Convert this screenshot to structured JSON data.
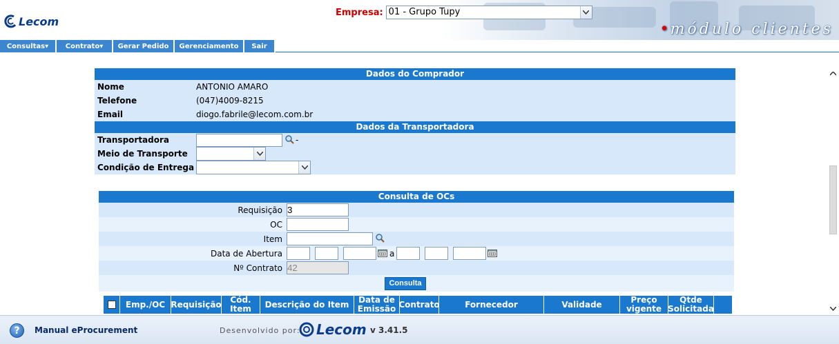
{
  "header": {
    "logo_text": "Lecom",
    "empresa_label": "Empresa:",
    "empresa_value": "01 - Grupo Tupy",
    "module_title": "módulo clientes"
  },
  "menu": [
    {
      "label": "Consultas",
      "has_dropdown": true
    },
    {
      "label": "Contrato",
      "has_dropdown": true
    },
    {
      "label": "Gerar Pedido",
      "has_dropdown": false
    },
    {
      "label": "Gerenciamento",
      "has_dropdown": false
    },
    {
      "label": "Sair",
      "has_dropdown": false
    }
  ],
  "comprador": {
    "title": "Dados do Comprador",
    "nome_label": "Nome",
    "nome": "ANTONIO AMARO",
    "telefone_label": "Telefone",
    "telefone": "(047)4009-8215",
    "email_label": "Email",
    "email": "diogo.fabrile@lecom.com.br"
  },
  "transportadora": {
    "title": "Dados da Transportadora",
    "transportadora_label": "Transportadora",
    "transportadora_value": "",
    "transportadora_suffix": "-",
    "meio_label": "Meio de Transporte",
    "meio_value": "",
    "condicao_label": "Condição de Entrega",
    "condicao_value": ""
  },
  "consulta": {
    "title": "Consulta de OCs",
    "requisicao_label": "Requisição",
    "requisicao_value": "3",
    "oc_label": "OC",
    "oc_value": "",
    "item_label": "Item",
    "item_value": "",
    "data_label": "Data de Abertura",
    "data_sep": "a",
    "contrato_label": "Nº Contrato",
    "contrato_value": "42",
    "button": "Consulta"
  },
  "table": {
    "columns": [
      "Emp./OC",
      "Requisição",
      "Cód. Item",
      "Descrição do Item",
      "Data de Emissão",
      "Contrato",
      "Fornecedor",
      "Validade",
      "Preço vigente",
      "Qtde Solicitada"
    ]
  },
  "footer": {
    "manual": "Manual eProcurement",
    "developed_by": "Desenvolvido por:",
    "logo_text": "Lecom",
    "version": "v 3.41.5"
  },
  "colors": {
    "accent": "#1a78cf",
    "row_bg": "#d7e8fb",
    "empresa_label": "#cc0000"
  }
}
